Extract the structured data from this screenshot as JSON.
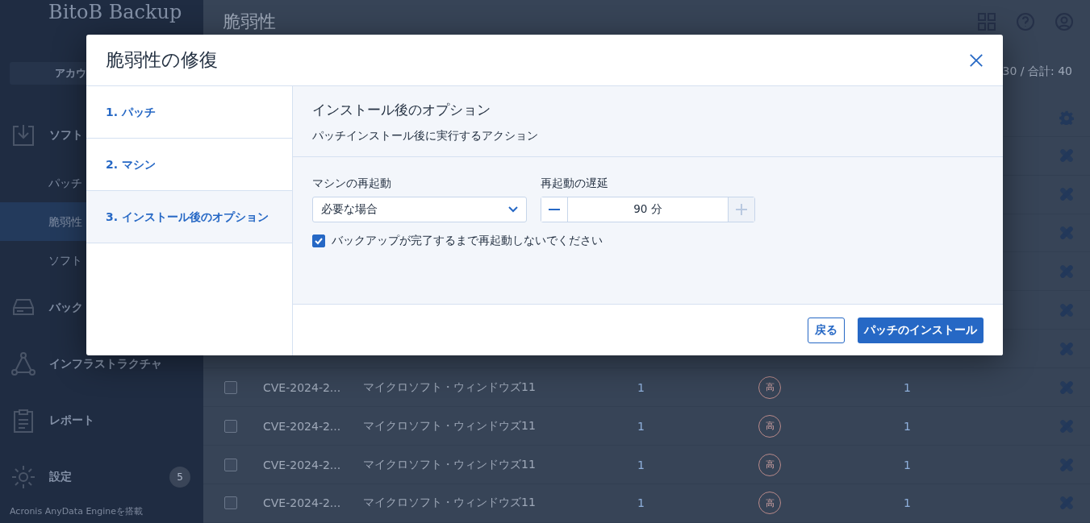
{
  "sidebar": {
    "logo": "BitoB Backup",
    "account_button": "アカウ",
    "items": [
      {
        "kind": "section",
        "label": "ソフト",
        "selected": false
      },
      {
        "kind": "sub",
        "label": "パッチ",
        "selected": false
      },
      {
        "kind": "sub",
        "label": "脆弱性",
        "selected": true
      },
      {
        "kind": "sub",
        "label": "ソフト",
        "selected": false
      },
      {
        "kind": "section",
        "label": "バック",
        "selected": false
      },
      {
        "kind": "section",
        "label": "インフラストラクチャ",
        "selected": false
      },
      {
        "kind": "section",
        "label": "レポート",
        "selected": false
      },
      {
        "kind": "section",
        "label": "設定",
        "selected": false,
        "badge": "5"
      }
    ],
    "footer": "Acronis AnyData Engineを搭載"
  },
  "main": {
    "title": "脆弱性",
    "count": "30 / 合計: 40",
    "rows": [
      {
        "checked": false,
        "cve": "CVE-2024-2...",
        "product": "マイクロソフト・ウィンドウズ11",
        "column_3": "1",
        "severity": "高",
        "column_5": "1"
      },
      {
        "checked": false,
        "cve": "CVE-2024-2...",
        "product": "マイクロソフト・ウィンドウズ11",
        "column_3": "1",
        "severity": "高",
        "column_5": "1"
      },
      {
        "checked": false,
        "cve": "CVE-2024-2...",
        "product": "マイクロソフト・ウィンドウズ11",
        "column_3": "1",
        "severity": "高",
        "column_5": "1"
      },
      {
        "checked": false,
        "cve": "CVE-2024-2...",
        "product": "マイクロソフト・ウィンドウズ11",
        "column_3": "1",
        "severity": "高",
        "column_5": "1"
      }
    ]
  },
  "dialog": {
    "title": "脆弱性の修復",
    "steps": [
      {
        "label": "1. パッチ",
        "selected": false
      },
      {
        "label": "2. マシン",
        "selected": false
      },
      {
        "label": "3. インストール後のオプション",
        "selected": true
      }
    ],
    "section_title": "インストール後のオプション",
    "section_subtitle": "パッチインストール後に実行するアクション",
    "restart": {
      "label": "マシンの再起動",
      "value": "必要な場合"
    },
    "delay": {
      "label": "再起動の遅延",
      "value": "90 分",
      "increment_disabled": true
    },
    "no_restart_during_backup": {
      "label": "バックアップが完了するまで再起動しないでください",
      "checked": true
    },
    "buttons": {
      "back": "戻る",
      "install": "パッチのインストール"
    }
  }
}
